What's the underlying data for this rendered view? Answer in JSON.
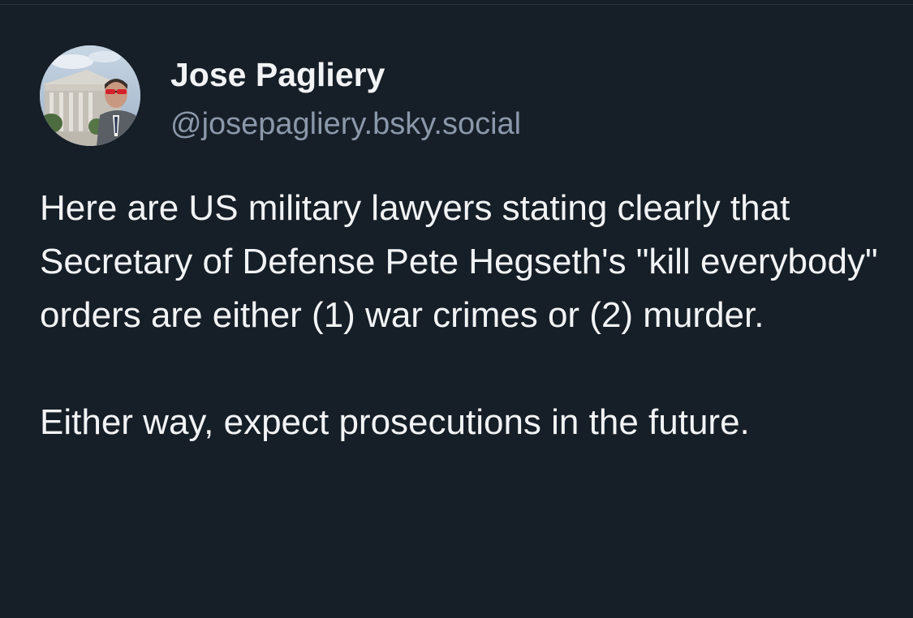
{
  "author": {
    "name": "Jose Pagliery",
    "handle": "@josepagliery.bsky.social",
    "avatar_icon": "profile-photo"
  },
  "post": {
    "paragraphs": [
      "Here are US military lawyers stating clearly that Secretary of Defense Pete Hegseth's \"kill everybody\" orders are either (1) war crimes or (2) murder.",
      "Either way, expect prosecutions in the future."
    ]
  },
  "colors": {
    "background": "#161e27",
    "text_primary": "#f1f3f5",
    "text_secondary": "#8b98a9"
  }
}
